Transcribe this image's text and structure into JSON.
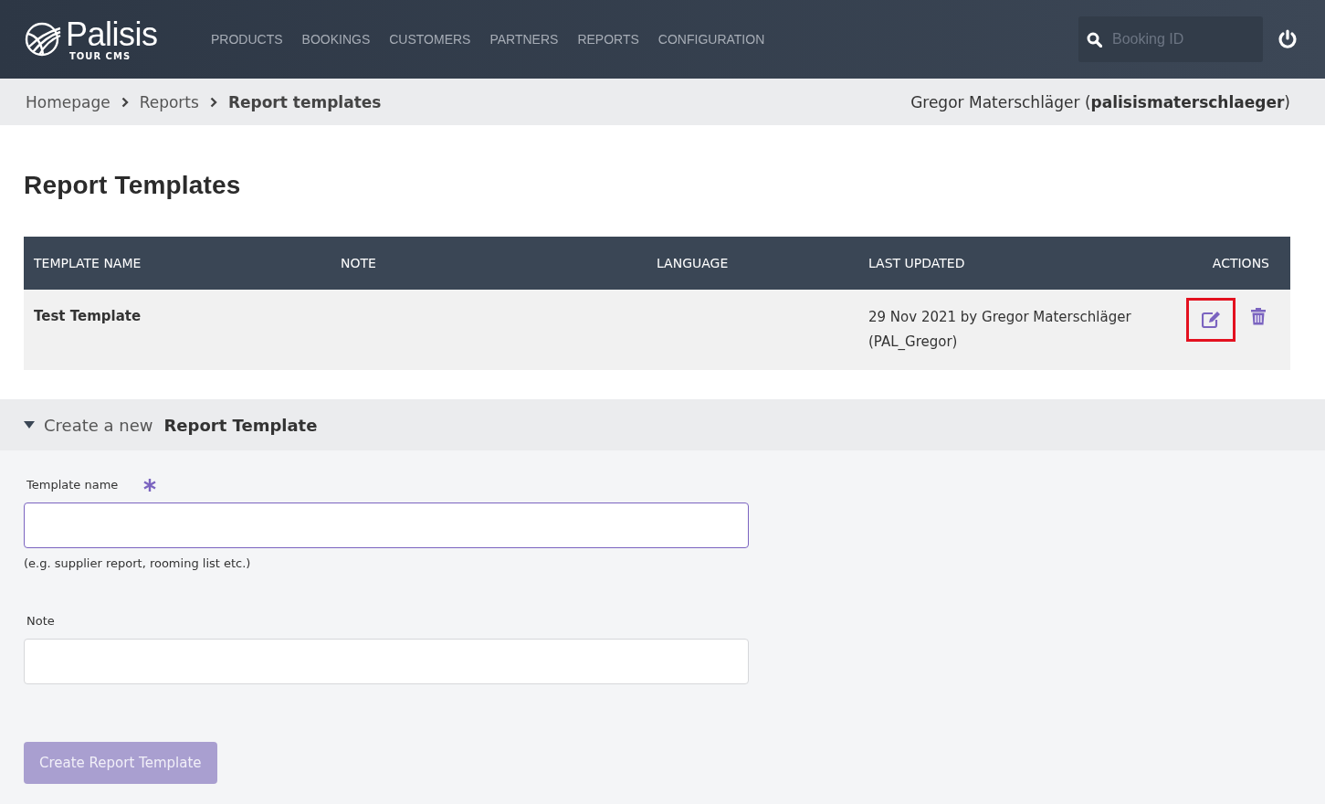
{
  "header": {
    "logo": {
      "name": "Palisis",
      "subtitle": "TOUR CMS"
    },
    "nav": [
      "PRODUCTS",
      "BOOKINGS",
      "CUSTOMERS",
      "PARTNERS",
      "REPORTS",
      "CONFIGURATION"
    ],
    "search": {
      "placeholder": "Booking ID"
    }
  },
  "breadcrumb": [
    {
      "label": "Homepage",
      "current": false
    },
    {
      "label": "Reports",
      "current": false
    },
    {
      "label": "Report templates",
      "current": true
    }
  ],
  "user": "Gregor Materschläger (**palisismaterschlaeger**)",
  "page_title": "Report Templates",
  "table": {
    "columns": [
      "TEMPLATE NAME",
      "NOTE",
      "LANGUAGE",
      "LAST UPDATED",
      "ACTIONS"
    ],
    "rows": [
      {
        "template_name": "Test Template",
        "last_updated": "29 Nov 2021 by Gregor Materschläger (PAL_Gregor)",
        "actions": [
          {
            "kind": "edit",
            "highlighted": true
          },
          {
            "kind": "delete",
            "highlighted": false
          }
        ]
      }
    ]
  },
  "create_section": {
    "expanded": true,
    "title_prefix": "Create a new",
    "title": "Report Template",
    "fields": [
      {
        "label": "Template name",
        "required": true,
        "focused": true,
        "hint": "(e.g. supplier report, rooming list etc.)"
      },
      {
        "label": "Note",
        "required": false,
        "focused": false
      }
    ],
    "submit": {
      "label": "Create Report Template",
      "disabled": true
    }
  }
}
